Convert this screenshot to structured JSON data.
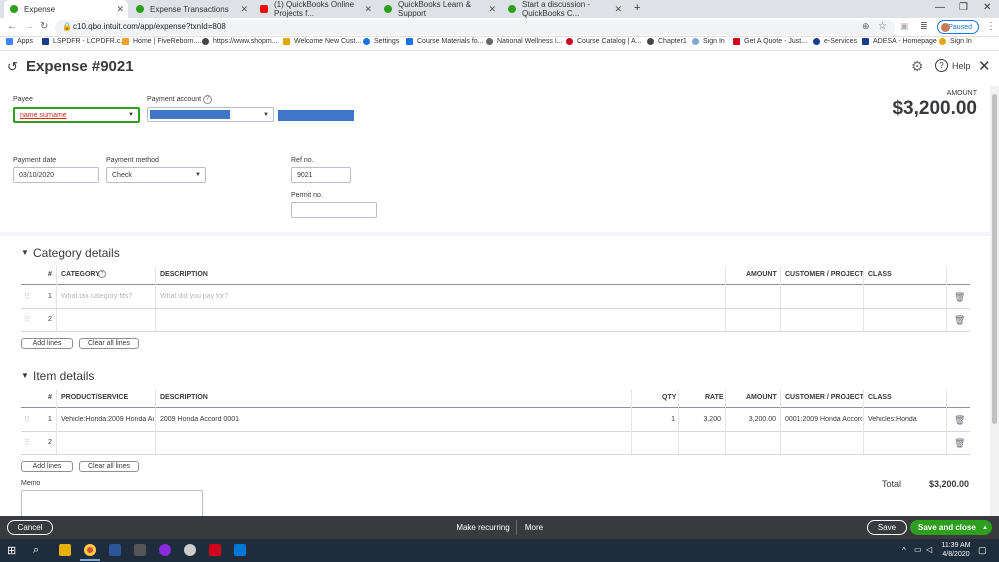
{
  "browser": {
    "tabs": [
      {
        "label": "Expense",
        "active": true,
        "color": "#2ca01c"
      },
      {
        "label": "Expense Transactions",
        "active": false,
        "color": "#2ca01c"
      },
      {
        "label": "(1) QuickBooks Online Projects f...",
        "active": false,
        "color": "#ff0000"
      },
      {
        "label": "QuickBooks Learn & Support",
        "active": false,
        "color": "#2ca01c"
      },
      {
        "label": "Start a discussion - QuickBooks C...",
        "active": false,
        "color": "#2ca01c"
      }
    ],
    "url": "c10.qbo.intuit.com/app/expense?txnId=808",
    "profile_status": "Paused",
    "bookmarks": [
      "Apps",
      "LSPDFR - LCPDFR.c...",
      "Home | FiveReborn....",
      "https://www.shopm...",
      "Welcome New Cust...",
      "Settings",
      "Course Materials fo...",
      "National Wellness I...",
      "Course Catalog | A...",
      "Chapter1",
      "Sign In",
      "Get A Quote - Just...",
      "e-Services",
      "ADESA - Homepage",
      "Sign In"
    ]
  },
  "header": {
    "title": "Expense #9021",
    "help": "Help"
  },
  "form": {
    "payee_label": "Payee",
    "payee_value": "name surname",
    "payment_account_label": "Payment account",
    "amount_label": "AMOUNT",
    "amount_value": "$3,200.00",
    "payment_date_label": "Payment date",
    "payment_date_value": "03/10/2020",
    "payment_method_label": "Payment method",
    "payment_method_value": "Check",
    "ref_no_label": "Ref no.",
    "ref_no_value": "9021",
    "permit_no_label": "Permit no.",
    "permit_no_value": ""
  },
  "category": {
    "title": "Category details",
    "columns": [
      "#",
      "CATEGORY",
      "DESCRIPTION",
      "AMOUNT",
      "CUSTOMER / PROJECT",
      "CLASS"
    ],
    "rows": [
      {
        "num": "1",
        "category": "What tax category fits?",
        "description": "What did you pay for?",
        "amount": "",
        "customer": "",
        "class": ""
      },
      {
        "num": "2",
        "category": "",
        "description": "",
        "amount": "",
        "customer": "",
        "class": ""
      }
    ],
    "add_lines": "Add lines",
    "clear_lines": "Clear all lines"
  },
  "items": {
    "title": "Item details",
    "columns": [
      "#",
      "PRODUCT/SERVICE",
      "DESCRIPTION",
      "QTY",
      "RATE",
      "AMOUNT",
      "CUSTOMER / PROJECT",
      "CLASS"
    ],
    "rows": [
      {
        "num": "1",
        "product": "Vehicle:Honda:2009 Honda Ac",
        "description": "2009 Honda Accord 0001",
        "qty": "1",
        "rate": "3,200",
        "amount": "3,200.00",
        "customer": "0001:2009 Honda Accord",
        "class": "Vehicles:Honda"
      },
      {
        "num": "2",
        "product": "",
        "description": "",
        "qty": "",
        "rate": "",
        "amount": "",
        "customer": "",
        "class": ""
      }
    ],
    "add_lines": "Add lines",
    "clear_lines": "Clear all lines"
  },
  "totals": {
    "total_label": "Total",
    "total_value": "$3,200.00"
  },
  "memo_label": "Memo",
  "footer": {
    "cancel": "Cancel",
    "make_recurring": "Make recurring",
    "more": "More",
    "save": "Save",
    "save_close": "Save and close"
  },
  "taskbar": {
    "time": "11:39 AM",
    "date": "4/8/2020"
  },
  "colors": {
    "qbo_green": "#2ca01c",
    "account_blue": "#3f76c6",
    "footer_bg": "#393a3d"
  }
}
